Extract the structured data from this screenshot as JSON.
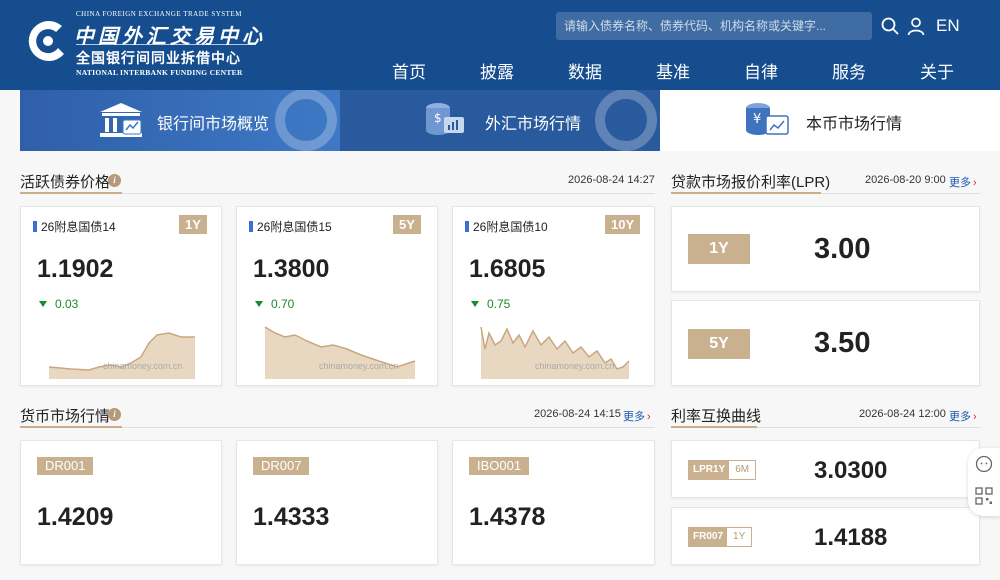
{
  "header": {
    "logo": {
      "en_top": "CHINA FOREIGN EXCHANGE TRADE SYSTEM",
      "cn_big": "中国外汇交易中心",
      "cn_small": "全国银行间同业拆借中心",
      "en_bottom": "NATIONAL INTERBANK FUNDING CENTER"
    },
    "search_placeholder": "请输入债券名称、债券代码、机构名称或关键字...",
    "lang": "EN",
    "nav": [
      "首页",
      "披露",
      "数据",
      "基准",
      "自律",
      "服务",
      "关于"
    ]
  },
  "market_tabs": [
    {
      "label": "银行间市场概览",
      "icon": "bank-building-icon"
    },
    {
      "label": "外汇市场行情",
      "icon": "coin-stack-chart-icon"
    },
    {
      "label": "本币市场行情",
      "icon": "yen-coin-chart-icon"
    }
  ],
  "active_bonds": {
    "title": "活跃债券价格",
    "time": "2026-08-24 14:27",
    "items": [
      {
        "name": "26附息国债14",
        "tenor": "1Y",
        "value": "1.1902",
        "change": "0.03",
        "watermark": "chinamoney.com.cn"
      },
      {
        "name": "26附息国债15",
        "tenor": "5Y",
        "value": "1.3800",
        "change": "0.70",
        "watermark": "chinamoney.com.cn"
      },
      {
        "name": "26附息国债10",
        "tenor": "10Y",
        "value": "1.6805",
        "change": "0.75",
        "watermark": "chinamoney.com.cn"
      }
    ]
  },
  "lpr": {
    "title": "贷款市场报价利率(LPR)",
    "time": "2026-08-20 9:00",
    "more": "更多",
    "items": [
      {
        "tenor": "1Y",
        "value": "3.00"
      },
      {
        "tenor": "5Y",
        "value": "3.50"
      }
    ]
  },
  "money_market": {
    "title": "货币市场行情",
    "time": "2026-08-24 14:15",
    "more": "更多",
    "items": [
      {
        "name": "DR001",
        "value": "1.4209"
      },
      {
        "name": "DR007",
        "value": "1.4333"
      },
      {
        "name": "IBO001",
        "value": "1.4378"
      }
    ]
  },
  "swap": {
    "title": "利率互换曲线",
    "time": "2026-08-24 12:00",
    "more": "更多",
    "items": [
      {
        "name": "LPR1Y",
        "tenor": "6M",
        "value": "3.0300"
      },
      {
        "name": "FR007",
        "tenor": "1Y",
        "value": "1.4188"
      }
    ]
  },
  "colors": {
    "header": "#154d8f",
    "accent_gold": "#c9b08f",
    "down_green": "#1a8a2a",
    "link_blue": "#1a57b0"
  }
}
